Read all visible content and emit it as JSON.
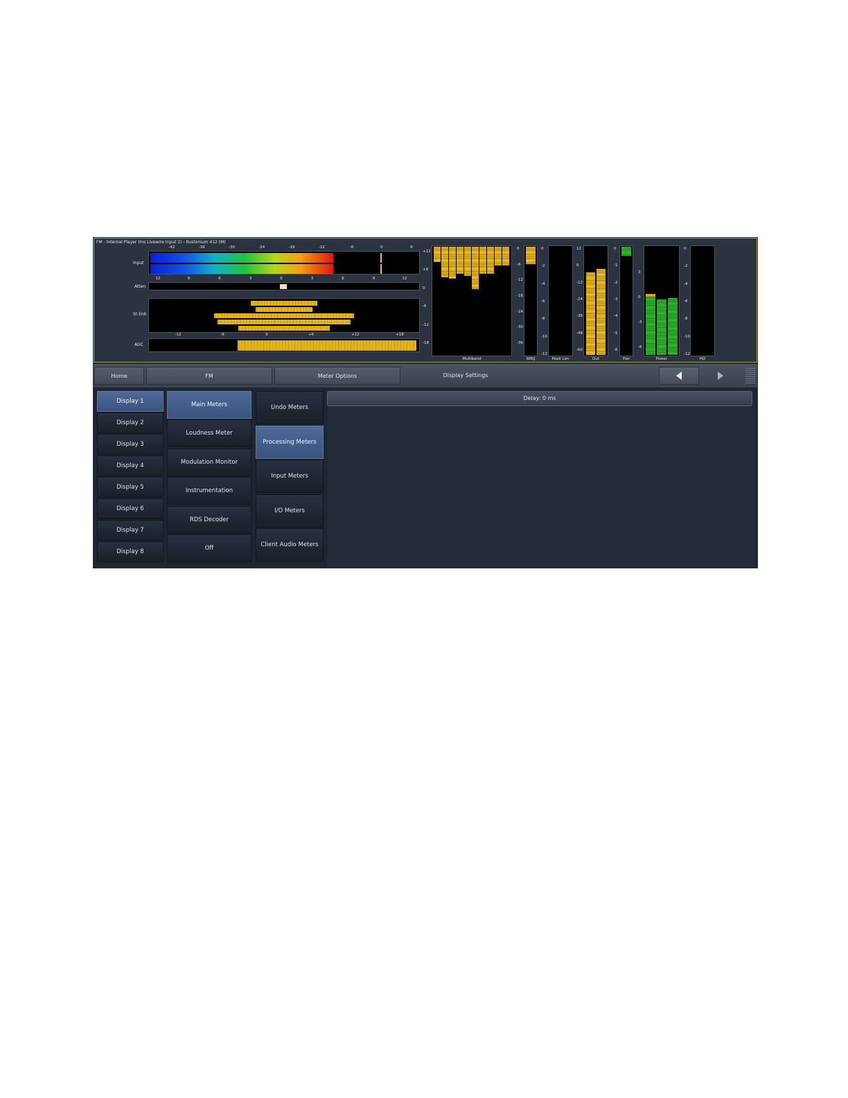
{
  "window_title": "FM - Internal Player (Ins Livewire Input 1) - Rustonium 412 (M)",
  "meters": {
    "input": {
      "label": "Input",
      "scale": [
        "-42",
        "-36",
        "-30",
        "-24",
        "-18",
        "-12",
        "-6",
        "0",
        "6"
      ],
      "level_left": 0.68,
      "level_right": 0.68,
      "peak": 0.86
    },
    "atten": {
      "label": "Atten",
      "scale": [
        "12",
        "9",
        "6",
        "3",
        "0",
        "3",
        "6",
        "9",
        "12"
      ],
      "value": 0.5
    },
    "stereo": {
      "label": "St Enh"
    },
    "agc": {
      "label": "AGC",
      "scale": [
        "-12",
        "-6",
        "0",
        "+6",
        "+12",
        "+18"
      ],
      "level_start": 0.33
    },
    "multiband": {
      "label": "Multiband",
      "scale": [
        "+12",
        "+6",
        "0",
        "-6",
        "-12",
        "-18"
      ],
      "bands": [
        0.14,
        0.28,
        0.29,
        0.25,
        0.27,
        0.39,
        0.25,
        0.25,
        0.17,
        0.17
      ]
    },
    "wb": {
      "label": "WB/J",
      "scale": [
        "0",
        "-6",
        "-12",
        "-18",
        "-24",
        "-30",
        "-36"
      ],
      "value": 0.16
    },
    "peak_lim": {
      "label": "Peak Lim",
      "scale": [
        "0",
        "-2",
        "-4",
        "-6",
        "-8",
        "-10",
        "-12"
      ]
    },
    "out": {
      "label": "Out",
      "scale": [
        "12",
        "0",
        "-12",
        "-24",
        "-36",
        "-48",
        "-60"
      ],
      "left": 0.76,
      "right": 0.79
    },
    "pwr": {
      "label": "Pwr",
      "scale": [
        "0",
        "-1",
        "-2",
        "-3",
        "-4",
        "-5",
        "-6"
      ],
      "value": 0.08
    },
    "power": {
      "label": "Power",
      "scale": [
        "3",
        "0",
        "-3",
        "-6"
      ],
      "bars": [
        0.56,
        0.51,
        0.52
      ]
    },
    "hd": {
      "label": "HD",
      "scale": [
        "0",
        "-2",
        "-4",
        "-6",
        "-8",
        "-10",
        "-12"
      ]
    }
  },
  "toolbar": {
    "home": "Home",
    "fm": "FM",
    "meter_options": "Meter Options",
    "display_settings": "Display Settings"
  },
  "displays": [
    "Display 1",
    "Display 2",
    "Display 3",
    "Display 4",
    "Display 5",
    "Display 6",
    "Display 7",
    "Display 8"
  ],
  "modes": [
    "Main Meters",
    "Loudness Meter",
    "Modulation Monitor",
    "Instrumentation",
    "RDS Decoder",
    "Off"
  ],
  "meter_sets": [
    "Undo Meters",
    "Processing Meters",
    "Input Meters",
    "I/O Meters",
    "Client Audio Meters"
  ],
  "delay": "Delay: 0 ms",
  "colors": {
    "accent": "#3a5480",
    "meter_yellow": "#f2c21c",
    "meter_green": "#2eb82e",
    "frame": "#9ca43a"
  }
}
